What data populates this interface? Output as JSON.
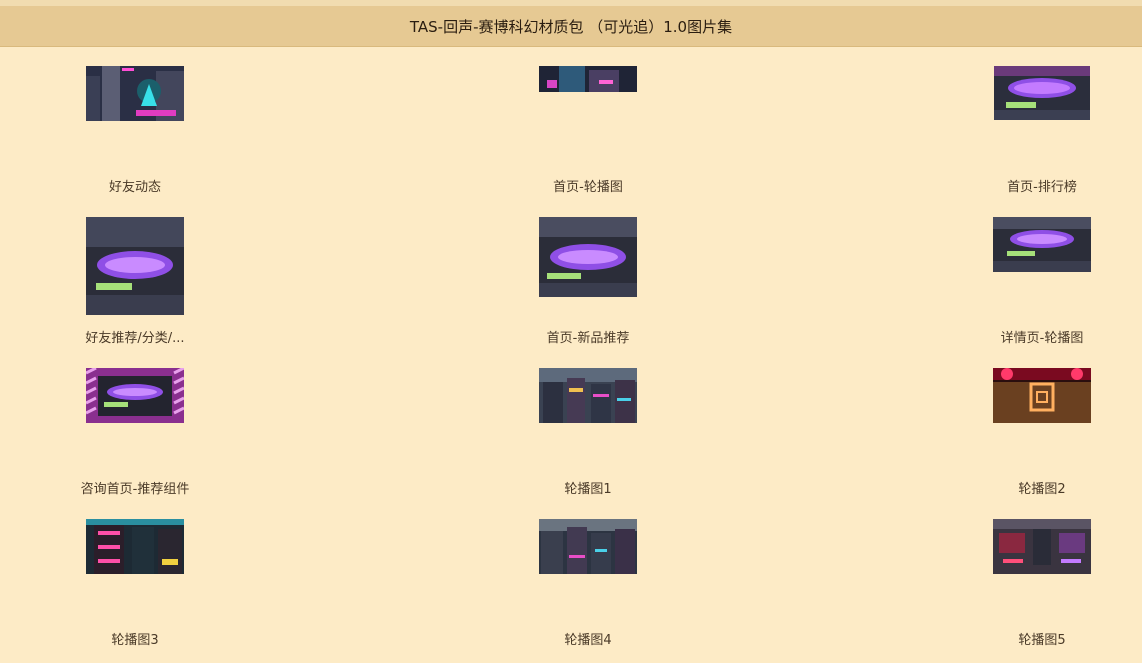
{
  "header": {
    "title": "TAS-回声-赛博科幻材质包 （可光追）1.0图片集"
  },
  "items": [
    {
      "label": "好友动态",
      "icon": "cyber-city-thumbnail"
    },
    {
      "label": "首页-轮播图",
      "icon": "cyber-banner-thumbnail"
    },
    {
      "label": "首页-排行榜",
      "icon": "echo-logo-thumbnail"
    },
    {
      "label": "好友推荐/分类/...",
      "icon": "echo-logo-thumbnail"
    },
    {
      "label": "首页-新品推荐",
      "icon": "echo-logo-thumbnail"
    },
    {
      "label": "详情页-轮播图",
      "icon": "echo-logo-thumbnail"
    },
    {
      "label": "咨询首页-推荐组件",
      "icon": "echo-logo-striped-thumbnail"
    },
    {
      "label": "轮播图1",
      "icon": "cyber-street-thumbnail"
    },
    {
      "label": "轮播图2",
      "icon": "neon-room-thumbnail"
    },
    {
      "label": "轮播图3",
      "icon": "neon-tower-thumbnail"
    },
    {
      "label": "轮播图4",
      "icon": "cyber-street-thumbnail"
    },
    {
      "label": "轮播图5",
      "icon": "cyber-interior-thumbnail"
    }
  ]
}
